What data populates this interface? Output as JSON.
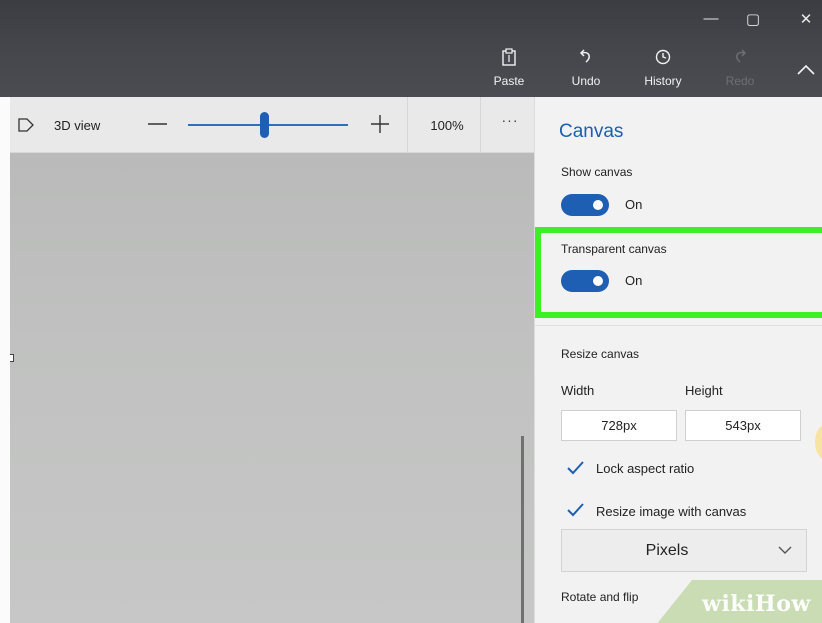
{
  "window": {
    "controls": {
      "minimize": "—",
      "restore": "▢",
      "close": "✕"
    }
  },
  "ribbon": {
    "paste_label": "Paste",
    "undo_label": "Undo",
    "history_label": "History",
    "redo_label": "Redo"
  },
  "toolbar": {
    "view3d_label": "3D view",
    "zoom_minus": "—",
    "zoom_plus": "+",
    "zoom_value": "100%",
    "zoom_level": 0.5,
    "more": "···"
  },
  "panel": {
    "title": "Canvas",
    "show_canvas": {
      "label": "Show canvas",
      "state": "On"
    },
    "transparent_canvas": {
      "label": "Transparent canvas",
      "state": "On"
    },
    "resize": {
      "heading": "Resize canvas",
      "width_label": "Width",
      "height_label": "Height",
      "width_value": "728px",
      "height_value": "543px",
      "lock_aspect_label": "Lock aspect ratio",
      "resize_with_canvas_label": "Resize image with canvas",
      "units_value": "Pixels"
    },
    "rotate_flip_heading": "Rotate and flip"
  },
  "watermark": {
    "part1": "wiki",
    "part2": "How"
  },
  "colors": {
    "accent": "#1f5fb3",
    "highlight": "#3df026",
    "title_bar": "#45474c"
  }
}
